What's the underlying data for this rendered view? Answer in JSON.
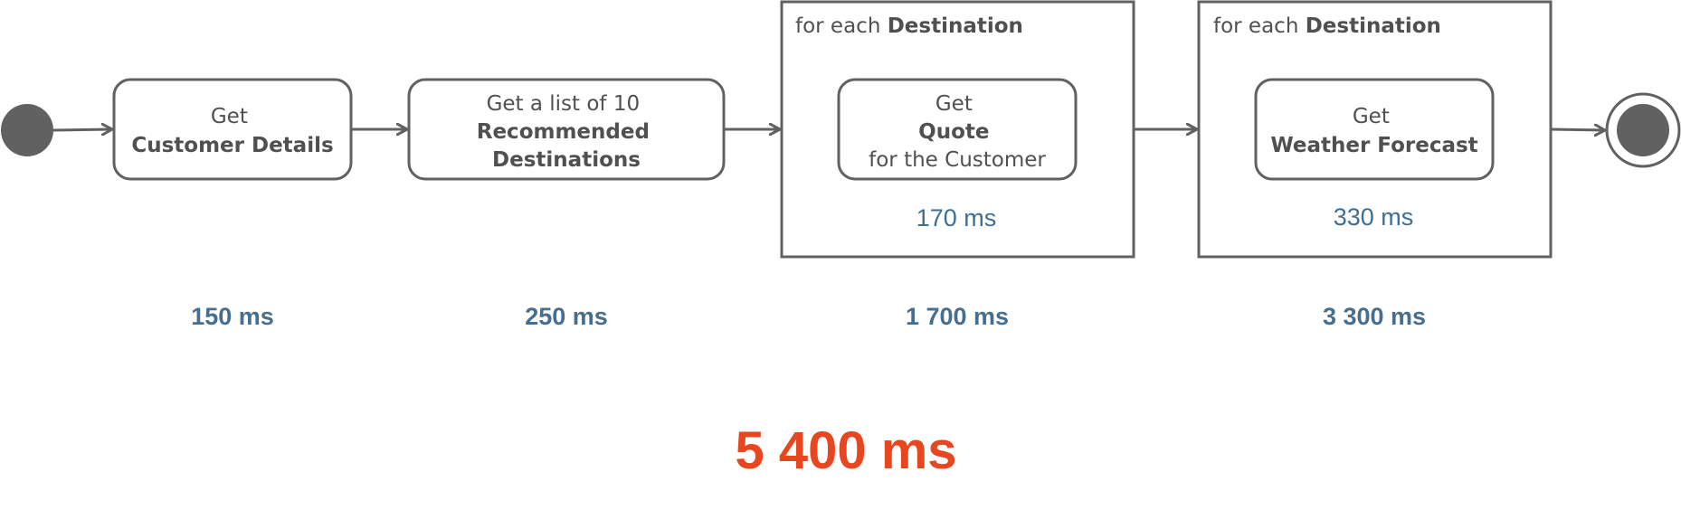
{
  "colors": {
    "stroke": "#616161",
    "text": "#505050",
    "step_time": "#456e8f",
    "total_time": "#e8461f"
  },
  "diagram": {
    "start_node": "initial-state",
    "end_node": "final-state",
    "steps": [
      {
        "id": "customer-details",
        "lines": [
          {
            "text": "Get",
            "bold": false
          },
          {
            "text": "Customer Details",
            "bold": true
          }
        ],
        "time": "150 ms"
      },
      {
        "id": "recommended-destinations",
        "lines": [
          {
            "text": "Get a list of 10",
            "bold": false
          },
          {
            "text": "Recommended",
            "bold": true
          },
          {
            "text": "Destinations",
            "bold": true
          }
        ],
        "time": "250 ms"
      },
      {
        "id": "quote",
        "loop": {
          "prefix": "for each ",
          "keyword": "Destination"
        },
        "lines": [
          {
            "text": "Get",
            "bold": false
          },
          {
            "text": "Quote",
            "bold": true
          },
          {
            "text": "for the Customer",
            "bold": false
          }
        ],
        "inner_time": "170 ms",
        "time": "1 700 ms"
      },
      {
        "id": "weather-forecast",
        "loop": {
          "prefix": "for each ",
          "keyword": "Destination"
        },
        "lines": [
          {
            "text": "Get",
            "bold": false
          },
          {
            "text": "Weather Forecast",
            "bold": true
          }
        ],
        "inner_time": "330 ms",
        "time": "3 300 ms"
      }
    ],
    "total_time": "5 400 ms"
  }
}
